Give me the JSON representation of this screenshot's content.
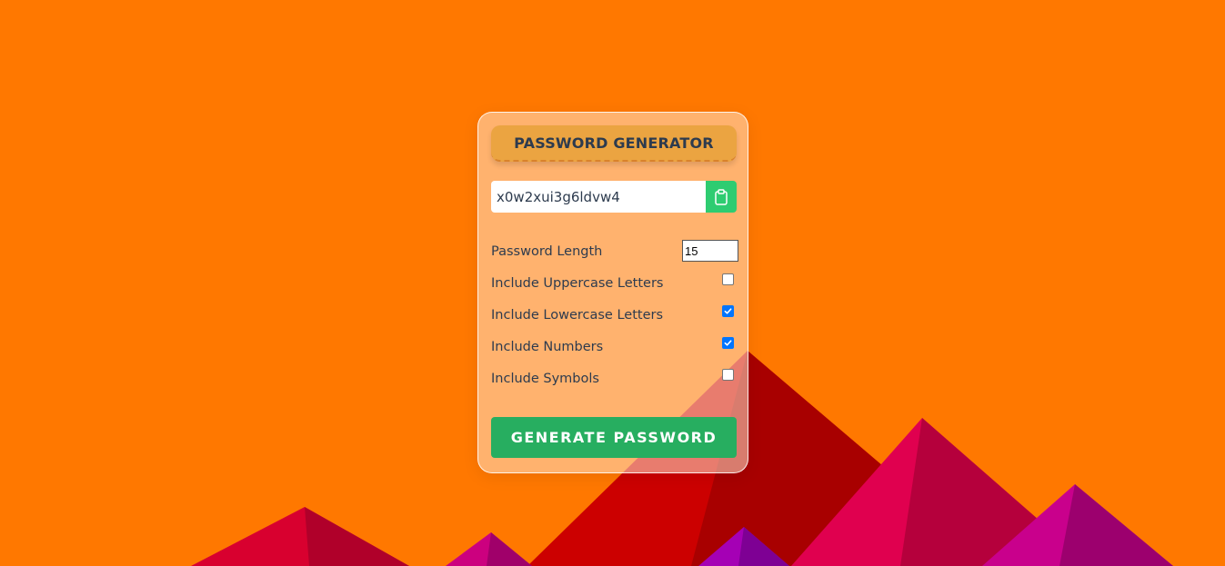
{
  "app": {
    "title": "PASSWORD GENERATOR"
  },
  "password": {
    "value": "x0w2xui3g6ldvw4",
    "copy_icon": "clipboard-icon"
  },
  "settings": {
    "length": {
      "label": "Password Length",
      "value": "15"
    },
    "uppercase": {
      "label": "Include Uppercase Letters",
      "checked": false
    },
    "lowercase": {
      "label": "Include Lowercase Letters",
      "checked": true
    },
    "numbers": {
      "label": "Include Numbers",
      "checked": true
    },
    "symbols": {
      "label": "Include Symbols",
      "checked": false
    }
  },
  "generate_button": {
    "label": "GENERATE PASSWORD"
  },
  "colors": {
    "background": "#ff7800",
    "title_bg": "#eba441",
    "copy_button": "#2ecc71",
    "generate_button": "#27ae60",
    "text": "#2d3b4e",
    "checkbox_checked": "#0075ff"
  }
}
